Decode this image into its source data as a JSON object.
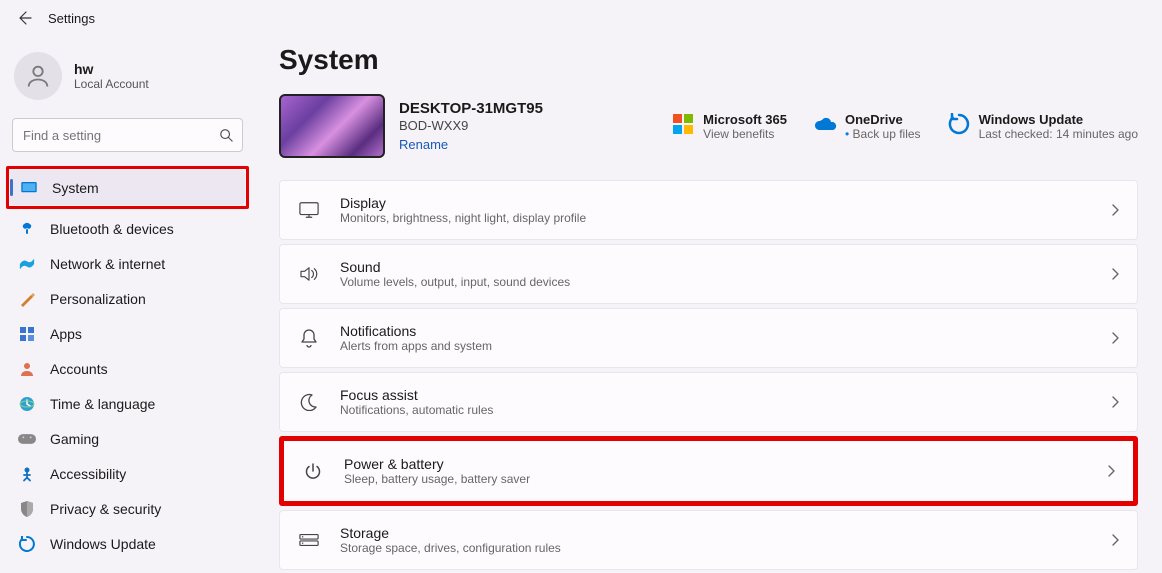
{
  "header": {
    "title": "Settings"
  },
  "user": {
    "name": "hw",
    "subtitle": "Local Account"
  },
  "search": {
    "placeholder": "Find a setting"
  },
  "nav": {
    "items": [
      {
        "label": "System",
        "selected": true,
        "highlight": true
      },
      {
        "label": "Bluetooth & devices"
      },
      {
        "label": "Network & internet"
      },
      {
        "label": "Personalization"
      },
      {
        "label": "Apps"
      },
      {
        "label": "Accounts"
      },
      {
        "label": "Time & language"
      },
      {
        "label": "Gaming"
      },
      {
        "label": "Accessibility"
      },
      {
        "label": "Privacy & security"
      },
      {
        "label": "Windows Update"
      }
    ]
  },
  "page": {
    "title": "System",
    "device": {
      "name": "DESKTOP-31MGT95",
      "model": "BOD-WXX9",
      "rename": "Rename"
    },
    "tiles": [
      {
        "title": "Microsoft 365",
        "sub": "View benefits"
      },
      {
        "title": "OneDrive",
        "sub": "Back up files",
        "dot": true
      },
      {
        "title": "Windows Update",
        "sub": "Last checked: 14 minutes ago"
      }
    ],
    "cards": [
      {
        "title": "Display",
        "sub": "Monitors, brightness, night light, display profile",
        "icon": "display"
      },
      {
        "title": "Sound",
        "sub": "Volume levels, output, input, sound devices",
        "icon": "sound"
      },
      {
        "title": "Notifications",
        "sub": "Alerts from apps and system",
        "icon": "bell"
      },
      {
        "title": "Focus assist",
        "sub": "Notifications, automatic rules",
        "icon": "moon"
      },
      {
        "title": "Power & battery",
        "sub": "Sleep, battery usage, battery saver",
        "icon": "power",
        "highlight": true
      },
      {
        "title": "Storage",
        "sub": "Storage space, drives, configuration rules",
        "icon": "storage"
      }
    ]
  }
}
